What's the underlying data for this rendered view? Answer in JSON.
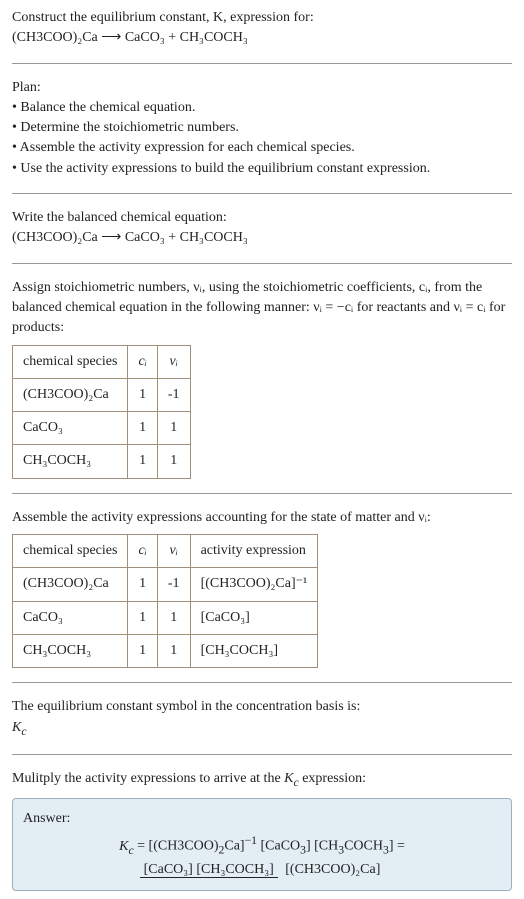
{
  "intro": {
    "line1": "Construct the equilibrium constant, K, expression for:",
    "eq": "(CH3COO)₂Ca ⟶ CaCO₃ + CH₃COCH₃"
  },
  "plan": {
    "title": "Plan:",
    "items": [
      "• Balance the chemical equation.",
      "• Determine the stoichiometric numbers.",
      "• Assemble the activity expression for each chemical species.",
      "• Use the activity expressions to build the equilibrium constant expression."
    ]
  },
  "balanced": {
    "title": "Write the balanced chemical equation:",
    "eq": "(CH3COO)₂Ca ⟶ CaCO₃ + CH₃COCH₃"
  },
  "assign": {
    "text": "Assign stoichiometric numbers, νᵢ, using the stoichiometric coefficients, cᵢ, from the balanced chemical equation in the following manner: νᵢ = −cᵢ for reactants and νᵢ = cᵢ for products:",
    "headers": [
      "chemical species",
      "cᵢ",
      "νᵢ"
    ],
    "rows": [
      {
        "species": "(CH3COO)₂Ca",
        "c": "1",
        "nu": "-1"
      },
      {
        "species": "CaCO₃",
        "c": "1",
        "nu": "1"
      },
      {
        "species": "CH₃COCH₃",
        "c": "1",
        "nu": "1"
      }
    ]
  },
  "assemble": {
    "text": "Assemble the activity expressions accounting for the state of matter and νᵢ:",
    "headers": [
      "chemical species",
      "cᵢ",
      "νᵢ",
      "activity expression"
    ],
    "rows": [
      {
        "species": "(CH3COO)₂Ca",
        "c": "1",
        "nu": "-1",
        "act": "[(CH3COO)₂Ca]⁻¹"
      },
      {
        "species": "CaCO₃",
        "c": "1",
        "nu": "1",
        "act": "[CaCO₃]"
      },
      {
        "species": "CH₃COCH₃",
        "c": "1",
        "nu": "1",
        "act": "[CH₃COCH₃]"
      }
    ]
  },
  "symbol": {
    "text": "The equilibrium constant symbol in the concentration basis is:",
    "sym": "K_c"
  },
  "multiply": {
    "text": "Mulitply the activity expressions to arrive at the K_c expression:"
  },
  "answer": {
    "label": "Answer:",
    "lhs": "K_c = [(CH3COO)₂Ca]⁻¹ [CaCO₃] [CH₃COCH₃] =",
    "frac_top": "[CaCO₃] [CH₃COCH₃]",
    "frac_bot": "[(CH3COO)₂Ca]"
  },
  "chart_data": {
    "type": "table",
    "tables": [
      {
        "title": "Stoichiometric numbers",
        "columns": [
          "chemical species",
          "c_i",
          "nu_i"
        ],
        "rows": [
          [
            "(CH3COO)2Ca",
            1,
            -1
          ],
          [
            "CaCO3",
            1,
            1
          ],
          [
            "CH3COCH3",
            1,
            1
          ]
        ]
      },
      {
        "title": "Activity expressions",
        "columns": [
          "chemical species",
          "c_i",
          "nu_i",
          "activity expression"
        ],
        "rows": [
          [
            "(CH3COO)2Ca",
            1,
            -1,
            "[(CH3COO)2Ca]^-1"
          ],
          [
            "CaCO3",
            1,
            1,
            "[CaCO3]"
          ],
          [
            "CH3COCH3",
            1,
            1,
            "[CH3COCH3]"
          ]
        ]
      }
    ],
    "equilibrium_constant": "K_c = [CaCO3][CH3COCH3] / [(CH3COO)2Ca]"
  }
}
